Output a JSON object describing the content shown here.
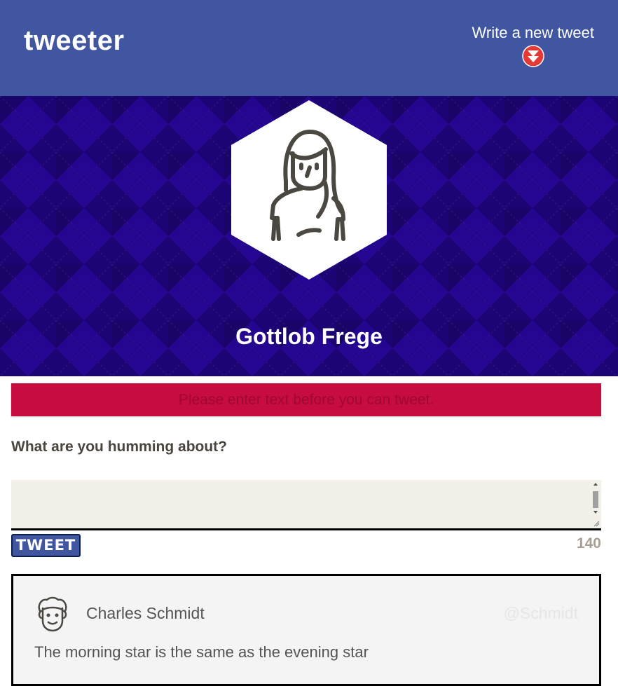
{
  "header": {
    "brand": "tweeter",
    "compose_label": "Write a new tweet"
  },
  "profile": {
    "name": "Gottlob Frege",
    "avatar_icon": "woman-avatar-icon"
  },
  "compose": {
    "error_message": "Please enter text before you can tweet.",
    "prompt": "What are you humming about?",
    "textarea_value": "",
    "button_label": "TWEET",
    "char_counter": "140"
  },
  "tweets": [
    {
      "author": "Charles Schmidt",
      "handle": "@Schmidt",
      "text": "The morning star is the same as the evening star",
      "avatar_icon": "curly-hair-man-avatar-icon"
    }
  ],
  "colors": {
    "header_bg": "#4056a0",
    "banner_bg": "#1d0475",
    "error_bg": "#c70c3f",
    "arrow_badge": "#e53935"
  }
}
